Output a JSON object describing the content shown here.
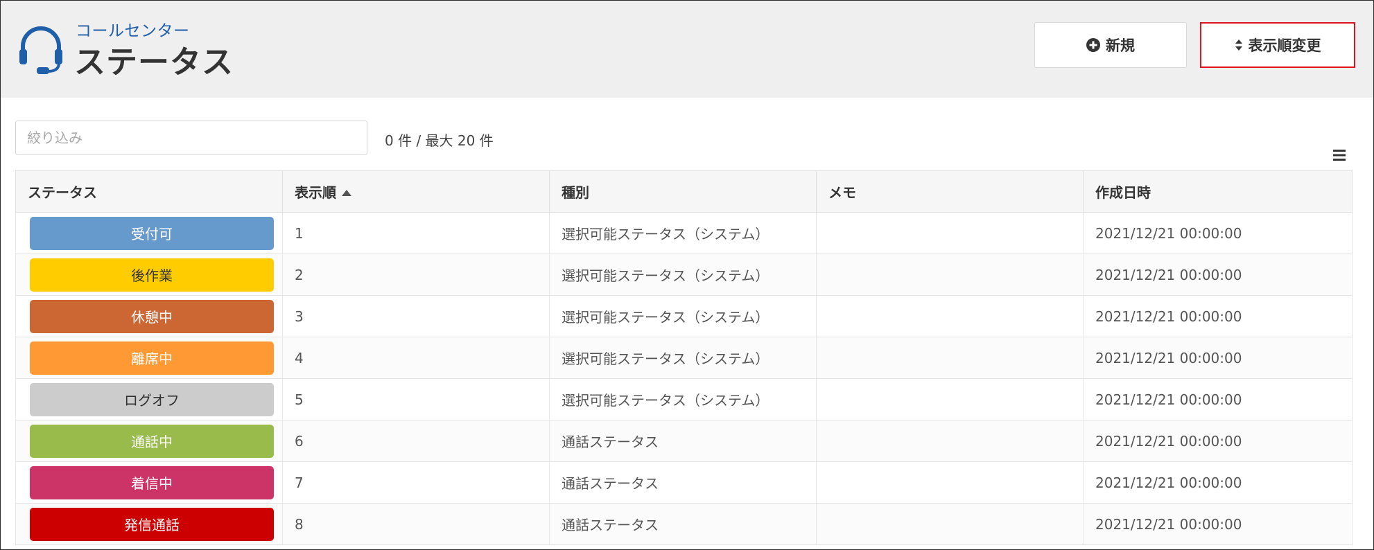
{
  "header": {
    "subtitle": "コールセンター",
    "title": "ステータス",
    "icon": "headset-icon"
  },
  "toolbar": {
    "new_label": "新規",
    "new_icon": "plus-circle-icon",
    "order_label": "表示順変更",
    "order_icon": "sort-icon"
  },
  "filter": {
    "placeholder": "絞り込み",
    "value": ""
  },
  "count_text": "0 件 / 最大 20 件",
  "table": {
    "columns": [
      "ステータス",
      "表示順",
      "種別",
      "メモ",
      "作成日時"
    ],
    "sort_column": "表示順",
    "sort_direction": "ascending",
    "rows": [
      {
        "status": "受付可",
        "color": "#6699cc",
        "text_color": "#ffffff",
        "order": "1",
        "type": "選択可能ステータス（システム）",
        "memo": "",
        "created": "2021/12/21 00:00:00"
      },
      {
        "status": "後作業",
        "color": "#ffcc00",
        "text_color": "#333333",
        "order": "2",
        "type": "選択可能ステータス（システム）",
        "memo": "",
        "created": "2021/12/21 00:00:00"
      },
      {
        "status": "休憩中",
        "color": "#cc6633",
        "text_color": "#ffffff",
        "order": "3",
        "type": "選択可能ステータス（システム）",
        "memo": "",
        "created": "2021/12/21 00:00:00"
      },
      {
        "status": "離席中",
        "color": "#ff9933",
        "text_color": "#ffffff",
        "order": "4",
        "type": "選択可能ステータス（システム）",
        "memo": "",
        "created": "2021/12/21 00:00:00"
      },
      {
        "status": "ログオフ",
        "color": "#cccccc",
        "text_color": "#333333",
        "order": "5",
        "type": "選択可能ステータス（システム）",
        "memo": "",
        "created": "2021/12/21 00:00:00"
      },
      {
        "status": "通話中",
        "color": "#99bb4c",
        "text_color": "#ffffff",
        "order": "6",
        "type": "通話ステータス",
        "memo": "",
        "created": "2021/12/21 00:00:00"
      },
      {
        "status": "着信中",
        "color": "#cc3366",
        "text_color": "#ffffff",
        "order": "7",
        "type": "通話ステータス",
        "memo": "",
        "created": "2021/12/21 00:00:00"
      },
      {
        "status": "発信通話",
        "color": "#cc0000",
        "text_color": "#ffffff",
        "order": "8",
        "type": "通話ステータス",
        "memo": "",
        "created": "2021/12/21 00:00:00"
      }
    ]
  },
  "colors": {
    "accent_blue": "#1f5ea8",
    "highlight_red": "#e0141e",
    "header_bg": "#efefef"
  }
}
